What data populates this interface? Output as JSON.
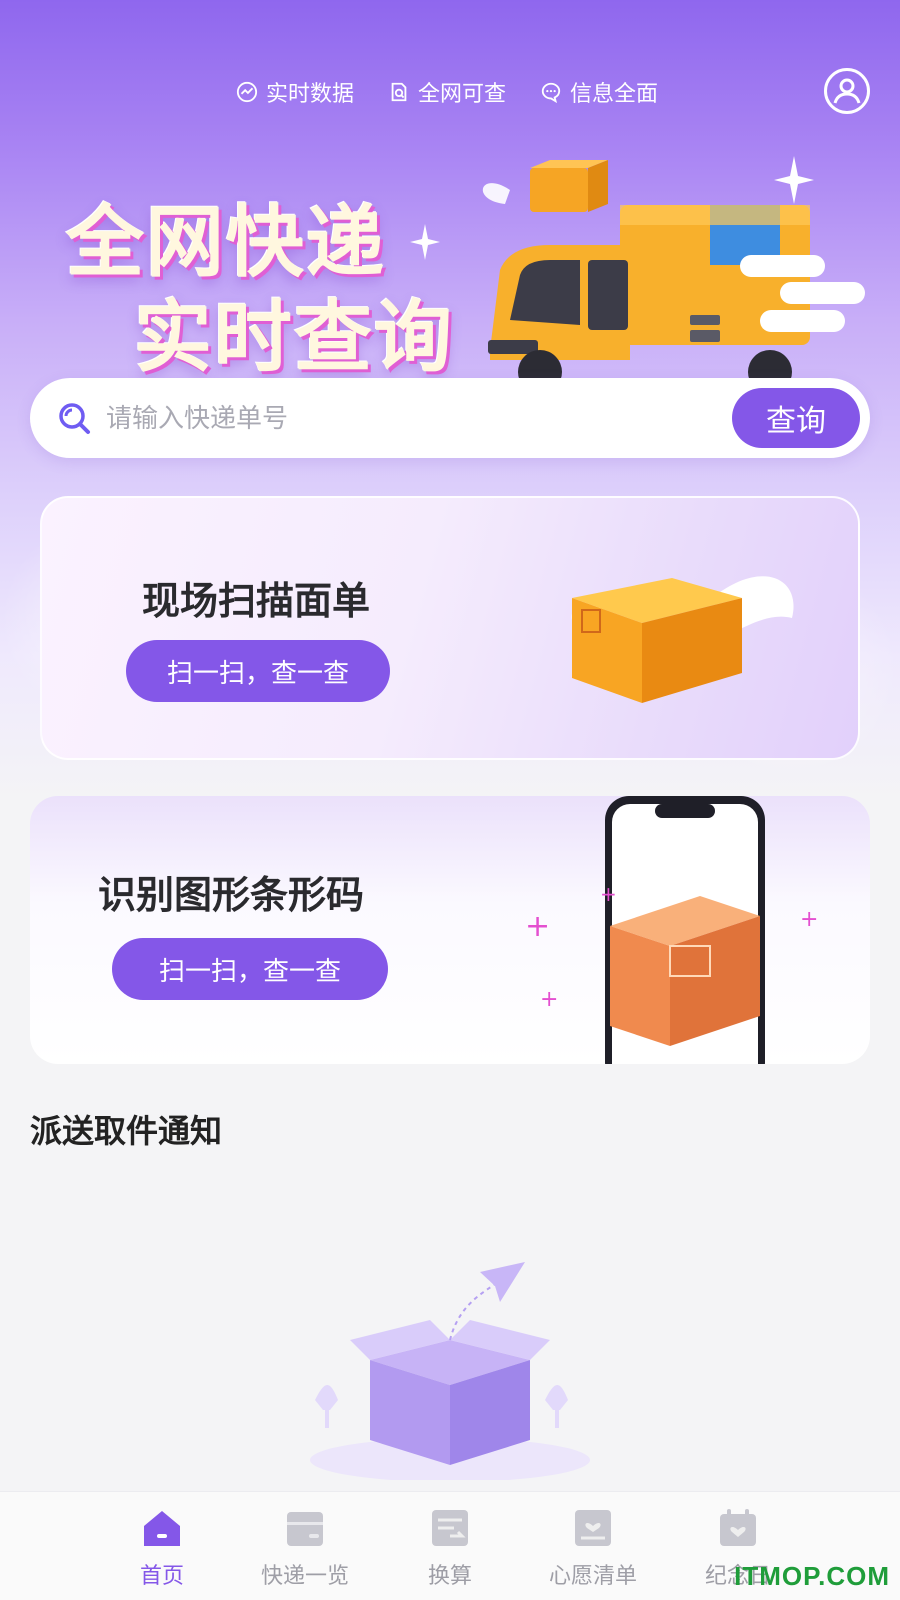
{
  "header": {
    "features": [
      {
        "label": "实时数据",
        "icon": "chart-circle-icon"
      },
      {
        "label": "全网可查",
        "icon": "doc-search-icon"
      },
      {
        "label": "信息全面",
        "icon": "chat-bubble-icon"
      }
    ],
    "avatar_icon": "user-icon"
  },
  "banner": {
    "line1": "全网快递",
    "line2": "实时查询"
  },
  "search": {
    "placeholder": "请输入快递单号",
    "button_label": "查询"
  },
  "cards": [
    {
      "title": "现场扫描面单",
      "button_label": "扫一扫，查一查"
    },
    {
      "title": "识别图形条形码",
      "button_label": "扫一扫，查一查"
    }
  ],
  "notice": {
    "title": "派送取件通知"
  },
  "tabbar": {
    "items": [
      {
        "label": "首页",
        "icon": "home-icon",
        "active": true
      },
      {
        "label": "快递一览",
        "icon": "package-icon",
        "active": false
      },
      {
        "label": "换算",
        "icon": "convert-icon",
        "active": false
      },
      {
        "label": "心愿清单",
        "icon": "wishlist-icon",
        "active": false
      },
      {
        "label": "纪念日",
        "icon": "calendar-heart-icon",
        "active": false
      }
    ]
  },
  "watermark": "ITMOP.COM",
  "colors": {
    "accent": "#8457e8",
    "tab_inactive": "#9e9ea6",
    "watermark": "#1f9d3a"
  }
}
